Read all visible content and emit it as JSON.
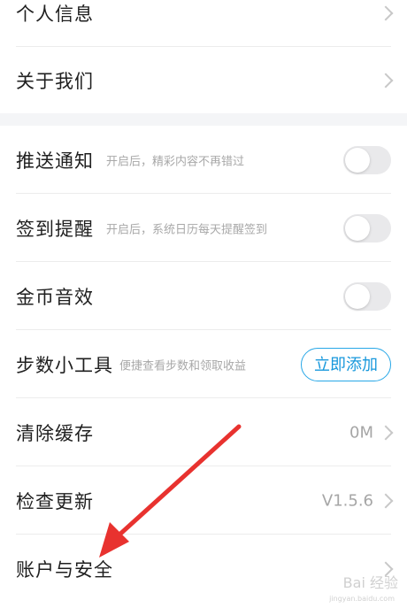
{
  "group1": {
    "items": [
      {
        "label": "个人信息"
      },
      {
        "label": "关于我们"
      }
    ]
  },
  "group2": {
    "push": {
      "label": "推送通知",
      "hint": "开启后，精彩内容不再错过",
      "enabled": false
    },
    "checkin": {
      "label": "签到提醒",
      "hint": "开启后，系统日历每天提醒签到",
      "enabled": false
    },
    "coin_sound": {
      "label": "金币音效",
      "enabled": false
    },
    "step_tool": {
      "label": "步数小工具",
      "hint": "便捷查看步数和领取收益",
      "button": "立即添加"
    },
    "clear_cache": {
      "label": "清除缓存",
      "value": "0M"
    },
    "check_update": {
      "label": "检查更新",
      "value": "V1.5.6"
    },
    "account": {
      "label": "账户与安全"
    }
  },
  "colors": {
    "accent": "#1798dc",
    "annotation_arrow": "#e8322f",
    "background": "#f4f5f7"
  },
  "watermark": {
    "text": "Bai 经验",
    "sub": "jingyan.baidu.com"
  }
}
